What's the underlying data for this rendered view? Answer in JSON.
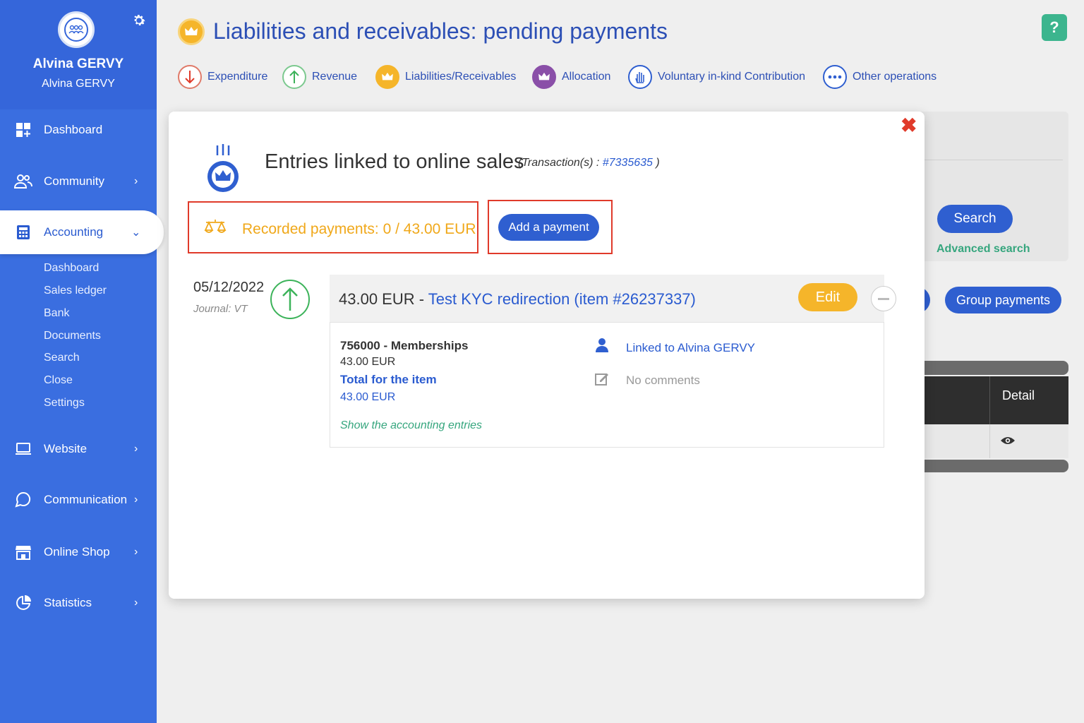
{
  "sidebar": {
    "user_name": "Alvina GERVY",
    "user_sub": "Alvina GERVY",
    "nav": [
      {
        "label": "Dashboard"
      },
      {
        "label": "Community"
      },
      {
        "label": "Accounting"
      },
      {
        "label": "Website"
      },
      {
        "label": "Communication"
      },
      {
        "label": "Online Shop"
      },
      {
        "label": "Statistics"
      }
    ],
    "accounting_sub": [
      "Dashboard",
      "Sales ledger",
      "Bank",
      "Documents",
      "Search",
      "Close",
      "Settings"
    ]
  },
  "header": {
    "title": "Liabilities and receivables: pending payments",
    "help": "?",
    "operations": [
      {
        "label": "Expenditure"
      },
      {
        "label": "Revenue"
      },
      {
        "label": "Liabilities/Receivables"
      },
      {
        "label": "Allocation"
      },
      {
        "label": "Voluntary in-kind Contribution"
      },
      {
        "label": "Other operations"
      }
    ]
  },
  "background": {
    "search_label": "Search",
    "advanced_search": "Advanced search",
    "group_payments": "Group payments",
    "detail_header": "Detail"
  },
  "modal": {
    "title": "Entries linked to online sales",
    "transaction_prefix": "(Transaction(s) : ",
    "transaction_id": "#7335635",
    "transaction_suffix": " )",
    "recorded_payments": "Recorded payments: 0 / 43.00 EUR",
    "add_payment": "Add a payment",
    "close": "✖",
    "entry": {
      "date": "05/12/2022",
      "journal": "Journal: VT",
      "amount": "43.00 EUR",
      "separator": " - ",
      "item_link": "Test KYC redirection (item #26237337)",
      "edit": "Edit",
      "account": "756000 - Memberships",
      "account_amount": "43.00 EUR",
      "total_label": "Total for the item",
      "total_amount": "43.00 EUR",
      "show_entries": "Show the accounting entries",
      "linked_to": "Linked to Alvina GERVY",
      "comments": "No comments"
    }
  },
  "colors": {
    "sidebar": "#3a6ee0",
    "primary": "#2f5fd0",
    "accent_yellow": "#f5b52a",
    "green": "#36a67e",
    "red_highlight": "#e03a2a"
  }
}
